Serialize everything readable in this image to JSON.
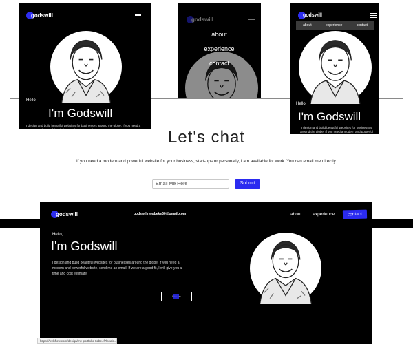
{
  "brand": {
    "logo_text": "godswill"
  },
  "hero": {
    "greeting": "Hello,",
    "name": "I'm Godswill",
    "intro_mobile": "I design and build beautiful websites for businesses around the globe. If you need a modern and powerful website, send me an email. If we are a",
    "intro_desktop": "I design and build beautiful websites for businesses around the globe. If you need a modern and powerful website, send me an email. If we are a good fit, I will give you a time and cost estimate.",
    "hire_label": "Hire me"
  },
  "nav": {
    "about": "about",
    "experience": "experience",
    "contact": "contact"
  },
  "contact_email": "godswillnwabeke50@gmail.com",
  "chat": {
    "title": "Let's chat",
    "text": "If you need a modern and powerful website for your business, start-ups or personally, I am available for work. You can email me directly.",
    "email_placeholder": "Email Me Here",
    "submit_label": "Submit"
  },
  "status": {
    "url": "https://webflow.com/design/my-portfolio-8dbe4f?locale=en"
  },
  "colors": {
    "accent": "#2b2bf0",
    "background": "#000000"
  },
  "icons": [
    "hamburger-menu-icon",
    "logo-dot-icon",
    "portrait-image"
  ]
}
